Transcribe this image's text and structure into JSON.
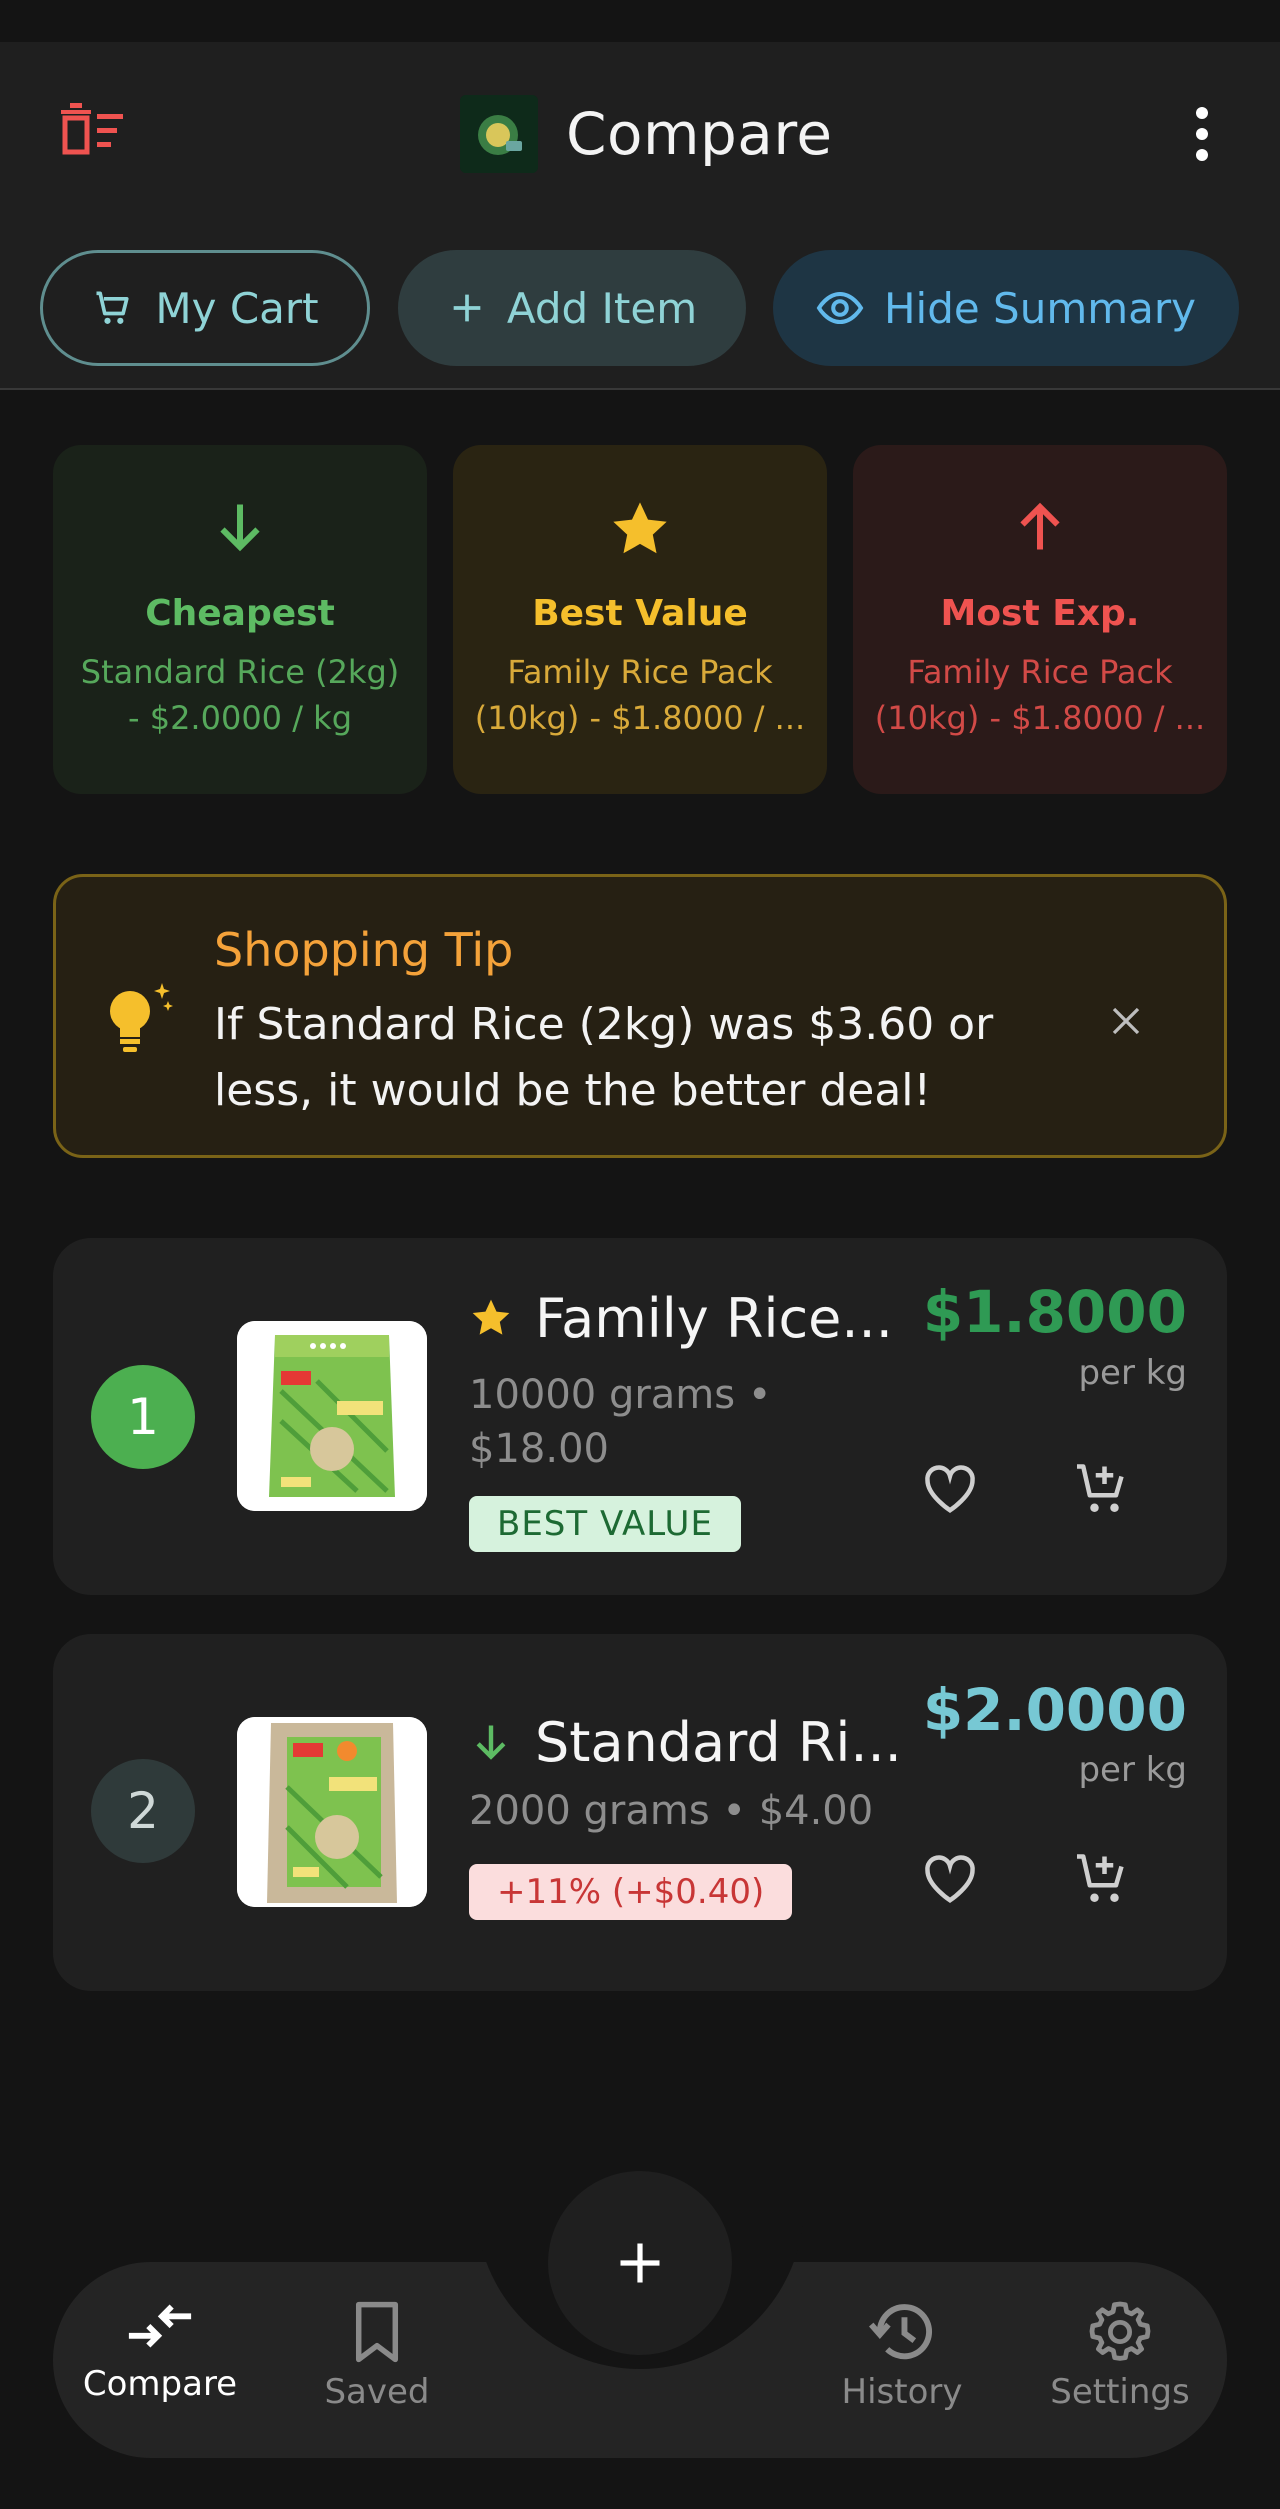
{
  "header": {
    "title": "Compare",
    "clear_icon": "delete-list-icon",
    "more_icon": "more-vert-icon",
    "logo_icon": "app-logo-icon"
  },
  "chips": {
    "cart_label": "My Cart",
    "add_label": "Add Item",
    "hide_label": "Hide Summary"
  },
  "summary": {
    "cheapest": {
      "title": "Cheapest",
      "line1": "Standard Rice (2kg)",
      "line2": "- $2.0000 / kg",
      "icon": "arrow-down-icon"
    },
    "best": {
      "title": "Best Value",
      "line1": "Family Rice Pack",
      "line2": "(10kg) - $1.8000 / ...",
      "icon": "star-icon"
    },
    "expensive": {
      "title": "Most Exp.",
      "line1": "Family Rice Pack",
      "line2": "(10kg) - $1.8000 / ...",
      "icon": "arrow-up-icon"
    }
  },
  "tip": {
    "title": "Shopping Tip",
    "body": "If Standard Rice (2kg) was $3.60 or less, it would be the better deal!",
    "icon": "lightbulb-icon"
  },
  "items": [
    {
      "rank": "1",
      "name": "Family Rice...",
      "meta1": "10000 grams •",
      "meta2": "$18.00",
      "badge": "BEST VALUE",
      "price": "$1.8000",
      "unit": "per kg"
    },
    {
      "rank": "2",
      "name": "Standard Ri...",
      "meta1": "2000 grams • $4.00",
      "badge": "+11% (+$0.40)",
      "price": "$2.0000",
      "unit": "per kg"
    }
  ],
  "nav": {
    "compare": "Compare",
    "saved": "Saved",
    "history": "History",
    "settings": "Settings"
  },
  "colors": {
    "accent_teal": "#8fd3d6",
    "green": "#4caf50",
    "gold": "#f5bf2c",
    "red": "#ef5350",
    "orange": "#f4a23a"
  }
}
